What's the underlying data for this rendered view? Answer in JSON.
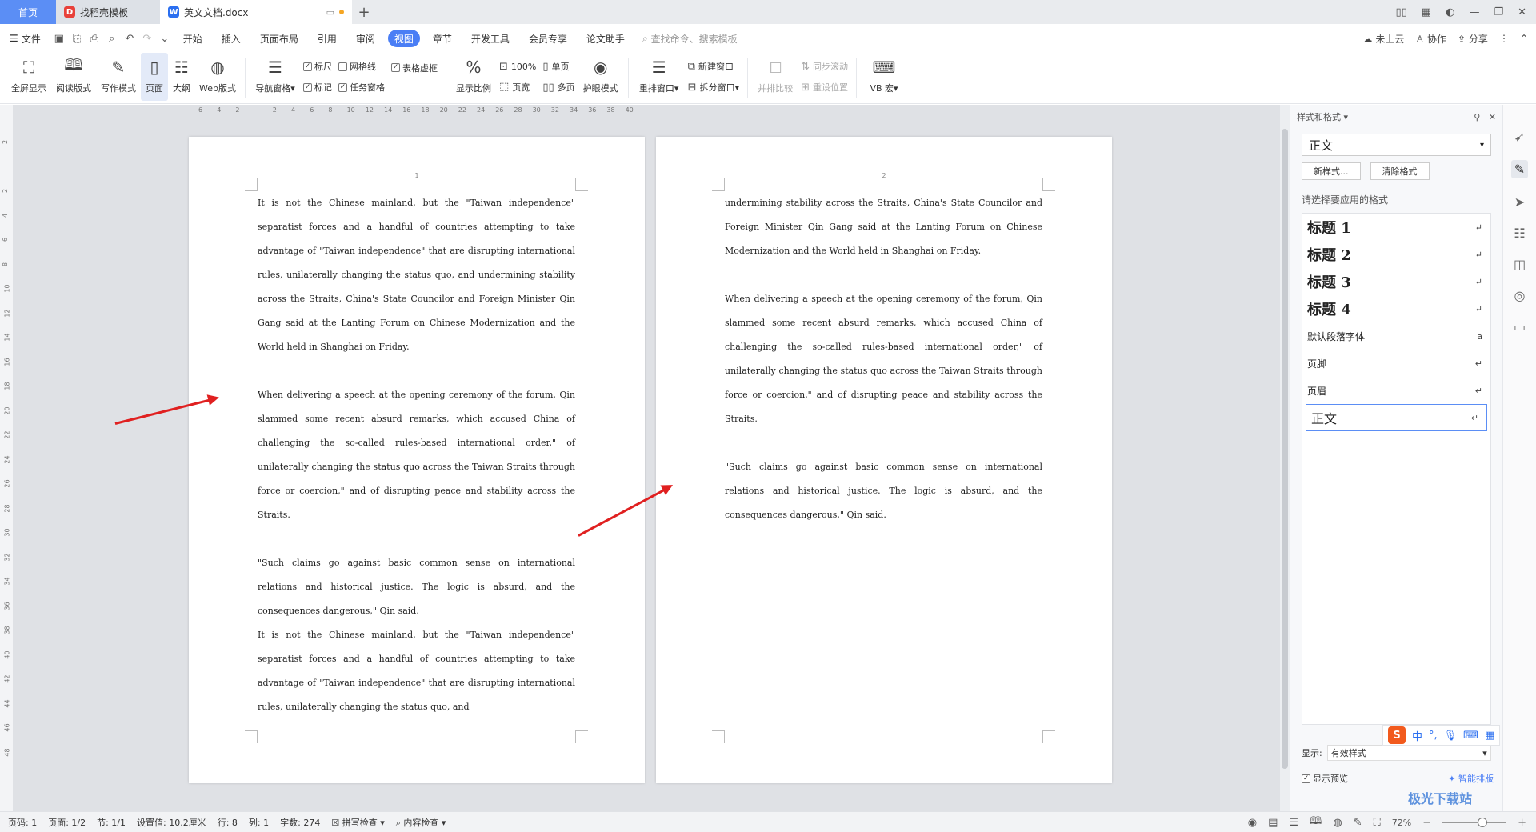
{
  "tabs": {
    "home": "首页",
    "template": "找稻壳模板",
    "doc": "英文文档.docx"
  },
  "menu": {
    "file": "文件",
    "items": [
      "开始",
      "插入",
      "页面布局",
      "引用",
      "审阅",
      "视图",
      "章节",
      "开发工具",
      "会员专享",
      "论文助手"
    ],
    "search": "查找命令、搜索模板",
    "cloud": "未上云",
    "collab": "协作",
    "share": "分享"
  },
  "ribbon": {
    "fullscreen": "全屏显示",
    "read": "阅读版式",
    "write": "写作模式",
    "page": "页面",
    "outline": "大纲",
    "web": "Web版式",
    "nav": "导航窗格",
    "ruler": "标尺",
    "grid": "网格线",
    "tablegrid": "表格虚框",
    "mark": "标记",
    "taskpane": "任务窗格",
    "zoom": "显示比例",
    "z100": "100%",
    "pagewidth": "页宽",
    "single": "单页",
    "multi": "多页",
    "eyecare": "护眼模式",
    "rearrange": "重排窗口",
    "newwin": "新建窗口",
    "split": "拆分窗口",
    "compare": "并排比较",
    "syncscroll": "同步滚动",
    "resetpos": "重设位置",
    "vbmacro": "VB 宏"
  },
  "ruler": {
    "h": [
      "6",
      "4",
      "2",
      "",
      "2",
      "4",
      "6",
      "8",
      "10",
      "12",
      "14",
      "16",
      "18",
      "20",
      "22",
      "24",
      "26",
      "28",
      "30",
      "32",
      "34",
      "36",
      "38",
      "40"
    ],
    "v": [
      "2",
      "",
      "2",
      "4",
      "6",
      "8",
      "10",
      "12",
      "14",
      "16",
      "18",
      "20",
      "22",
      "24",
      "26",
      "28",
      "30",
      "32",
      "34",
      "36",
      "38",
      "40",
      "42",
      "44",
      "46",
      "48"
    ]
  },
  "page1": {
    "num": "1",
    "p1": "It is not the Chinese mainland, but the \"Taiwan independence\" separatist forces and a handful of countries attempting to take advantage of \"Taiwan independence\" that are disrupting international rules, unilaterally changing the status quo, and undermining stability across the Straits, China's State Councilor and Foreign Minister Qin Gang said at the Lanting Forum on Chinese Modernization and the World held in Shanghai on Friday.",
    "p2": "When delivering a speech at the opening ceremony of the forum, Qin slammed some recent absurd remarks, which accused China of challenging the so-called rules-based international order,\" of unilaterally changing the status quo across the Taiwan Straits through force or coercion,\" and of disrupting peace and stability across the Straits.",
    "p3": "\"Such claims go against basic common sense on international relations and historical justice. The logic is absurd, and the consequences dangerous,\" Qin said.",
    "p4": "It is not the Chinese mainland, but the \"Taiwan independence\" separatist forces and a handful of countries attempting to take advantage of \"Taiwan independence\" that are disrupting international rules, unilaterally changing the status quo, and"
  },
  "page2": {
    "num": "2",
    "p1": "undermining stability across the Straits, China's State Councilor and Foreign Minister Qin Gang said at the Lanting Forum on Chinese Modernization and the World held in Shanghai on Friday.",
    "p2": "When delivering a speech at the opening ceremony of the forum, Qin slammed some recent absurd remarks, which accused China of challenging the so-called rules-based international order,\" of unilaterally changing the status quo across the Taiwan Straits through force or coercion,\" and of disrupting peace and stability across the Straits.",
    "p3": "\"Such claims go against basic common sense on international relations and historical justice. The logic is absurd, and the consequences dangerous,\" Qin said."
  },
  "panel": {
    "title": "样式和格式",
    "current": "正文",
    "newstyle": "新样式...",
    "clear": "清除格式",
    "label": "请选择要应用的格式",
    "styles": [
      {
        "name": "标题  1",
        "mark": "↵"
      },
      {
        "name": "标题  2",
        "mark": "↵"
      },
      {
        "name": "标题  3",
        "mark": "↵"
      },
      {
        "name": "标题  4",
        "mark": "↵"
      },
      {
        "name": "默认段落字体",
        "mark": "a"
      },
      {
        "name": "页脚",
        "mark": "↵"
      },
      {
        "name": "页眉",
        "mark": "↵"
      },
      {
        "name": "正文",
        "mark": "↵"
      }
    ],
    "show_label": "显示:",
    "show_value": "有效样式",
    "preview": "显示预览",
    "smart": "智能排版"
  },
  "status": {
    "pageno": "页码: 1",
    "pages": "页面: 1/2",
    "section": "节: 1/1",
    "setting": "设置值: 10.2厘米",
    "row": "行: 8",
    "col": "列: 1",
    "words": "字数: 274",
    "spell": "拼写检查",
    "content": "内容检查",
    "zoom": "72%"
  },
  "ime": {
    "lang": "中"
  },
  "watermark": "极光下载站",
  "colors": {
    "accent": "#4a7ef5",
    "arrow": "#e02020",
    "home_tab": "#5b8ef5"
  }
}
